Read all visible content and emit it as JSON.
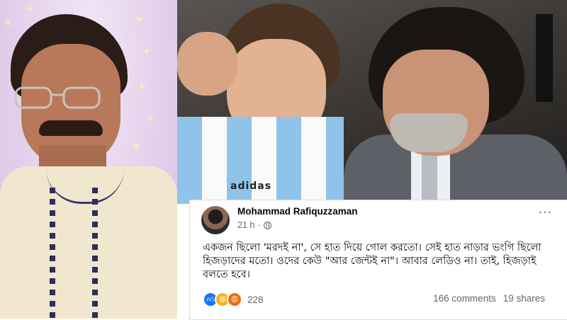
{
  "post": {
    "author": "Mohammad Rafiquzzaman",
    "time": "21 h",
    "time_separator": "·",
    "more_icon": "more-horizontal-icon",
    "body": "একজন ছিলো 'মরদই না', সে হাত দিয়ে গোল করতো। সেই হাত নাড়ার ভংগি ছিলো হিজড়াদের মতো। ওদের কেউ \"আর জেন্টই না\"। আবার লেডিও না। তাই, হিজড়াই বলতে হবে।",
    "reaction_icons": [
      "like-icon",
      "haha-icon",
      "angry-icon"
    ],
    "reaction_count": "228",
    "comments": "166 comments",
    "shares": "19 shares"
  },
  "photo": {
    "jersey_brand": "adidas"
  },
  "colors": {
    "facebook_blue": "#1877f2",
    "haha_yellow": "#f7b125",
    "angry_orange": "#e9710f",
    "secondary_text": "#65676b"
  }
}
